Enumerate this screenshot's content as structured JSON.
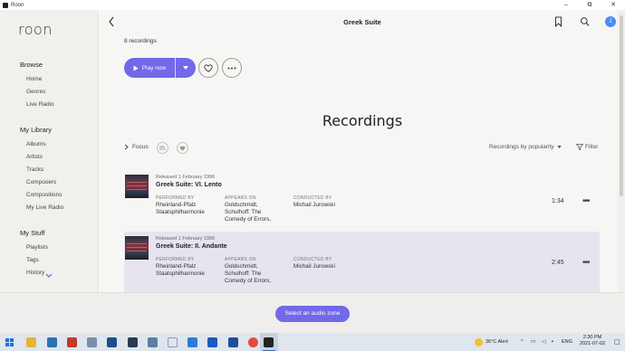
{
  "window": {
    "title": "Roon",
    "minimize": "–",
    "maximize": "⧉",
    "close": "✕"
  },
  "sidebar": {
    "logo": "roon",
    "sections": [
      {
        "heading": "Browse",
        "items": [
          "Home",
          "Genres",
          "Live Radio"
        ]
      },
      {
        "heading": "My Library",
        "items": [
          "Albums",
          "Artists",
          "Tracks",
          "Composers",
          "Compositions",
          "My Live Radio"
        ]
      },
      {
        "heading": "My Stuff",
        "items": [
          "Playlists",
          "Tags",
          "History"
        ]
      }
    ]
  },
  "header": {
    "title": "Greek Suite",
    "avatar_initial": "J"
  },
  "main": {
    "count": "8 recordings",
    "play_label": "Play now",
    "section_title": "Recordings",
    "focus_label": "Focus",
    "sort_label": "Recordings by popularity",
    "filter_label": "Filter",
    "labels": {
      "performed_by": "PERFORMED BY",
      "appears_on": "APPEARS ON",
      "conducted_by": "CONDUCTED BY"
    },
    "recordings": [
      {
        "released": "Released 1 February 1996",
        "title": "Greek Suite: VI. Lento",
        "performer": [
          "Rheinland-Pfalz",
          "Staatsphilharmonie"
        ],
        "appears_on": [
          "Goldschmidt,",
          "Schulhoff: The",
          "Comedy of Errors,"
        ],
        "conductor": "Michail Jurowski",
        "duration": "1:34",
        "more": "•••"
      },
      {
        "released": "Released 1 February 1996",
        "title": "Greek Suite: II. Andante",
        "performer": [
          "Rheinland-Pfalz",
          "Staatsphilharmonie"
        ],
        "appears_on": [
          "Goldschmidt,",
          "Schulhoff: The",
          "Comedy of Errors,"
        ],
        "conductor": "Michail Jurowski",
        "duration": "2:45",
        "more": "•••"
      }
    ]
  },
  "zone_button": "Select an audio zone",
  "taskbar": {
    "weather": "36°C  Alert",
    "language": "ENG",
    "time": "2:30 PM",
    "date": "2021-07-02"
  },
  "colors": {
    "accent": "#7169e8",
    "sidebar_bg": "#f2f0ed",
    "main_bg": "#f7f6f4",
    "row_highlight": "#e6e4ee"
  }
}
